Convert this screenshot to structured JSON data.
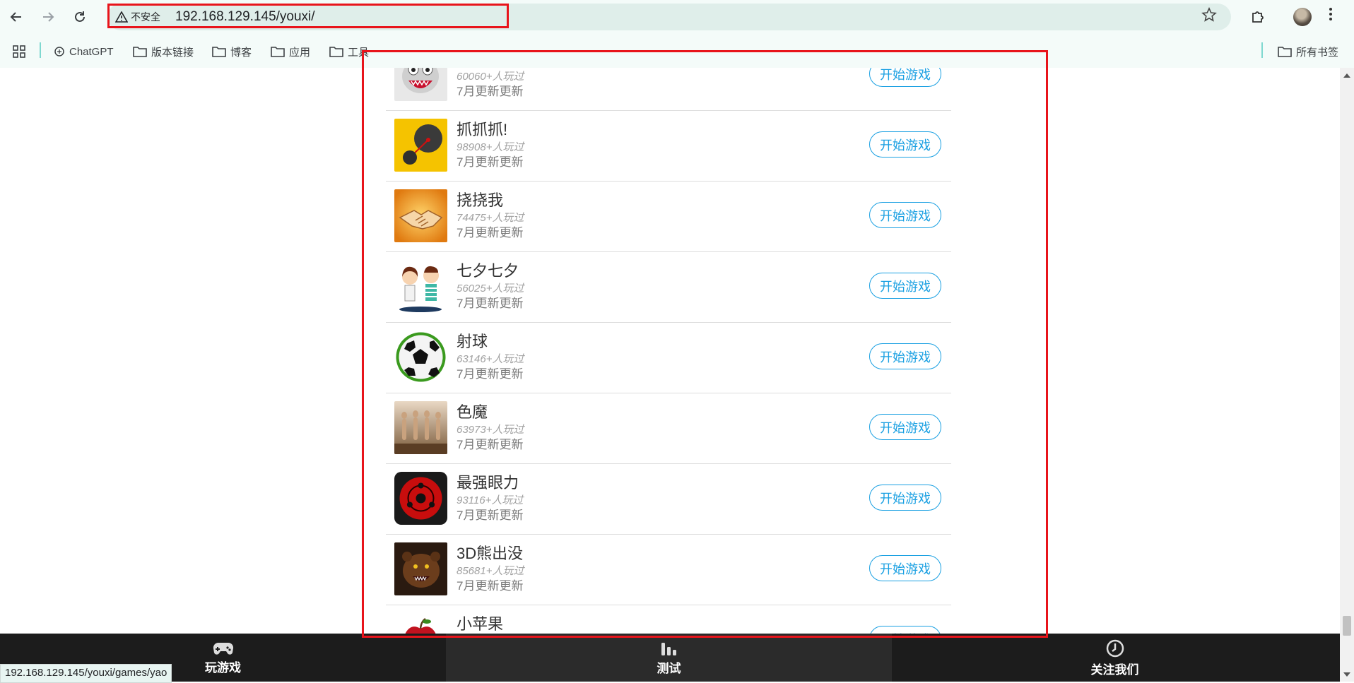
{
  "browser": {
    "security_label": "不安全",
    "url": "192.168.129.145/youxi/",
    "bookmarks": [
      {
        "label": "ChatGPT",
        "icon": "chatgpt-icon"
      },
      {
        "label": "版本链接",
        "icon": "folder-icon"
      },
      {
        "label": "博客",
        "icon": "folder-icon"
      },
      {
        "label": "应用",
        "icon": "folder-icon"
      },
      {
        "label": "工具",
        "icon": "folder-icon"
      }
    ],
    "all_bookmarks_label": "所有书签",
    "status_bar_url": "192.168.129.145/youxi/games/yao"
  },
  "games": [
    {
      "title": "",
      "plays": "60060+人玩过",
      "update": "7月更新更新",
      "button": "开始游戏",
      "icon": "monster-icon"
    },
    {
      "title": "抓抓抓!",
      "plays": "98908+人玩过",
      "update": "7月更新更新",
      "button": "开始游戏",
      "icon": "grab-icon"
    },
    {
      "title": "挠挠我",
      "plays": "74475+人玩过",
      "update": "7月更新更新",
      "button": "开始游戏",
      "icon": "handshake-icon"
    },
    {
      "title": "七夕七夕",
      "plays": "56025+人玩过",
      "update": "7月更新更新",
      "button": "开始游戏",
      "icon": "couple-icon"
    },
    {
      "title": "射球",
      "plays": "63146+人玩过",
      "update": "7月更新更新",
      "button": "开始游戏",
      "icon": "soccer-ball-icon"
    },
    {
      "title": "色魔",
      "plays": "63973+人玩过",
      "update": "7月更新更新",
      "button": "开始游戏",
      "icon": "figures-icon"
    },
    {
      "title": "最强眼力",
      "plays": "93116+人玩过",
      "update": "7月更新更新",
      "button": "开始游戏",
      "icon": "sharingan-eye-icon"
    },
    {
      "title": "3D熊出没",
      "plays": "85681+人玩过",
      "update": "7月更新更新",
      "button": "开始游戏",
      "icon": "bear-icon"
    },
    {
      "title": "小苹果",
      "plays": "",
      "update": "",
      "button": "开始游戏",
      "icon": "apple-icon"
    }
  ],
  "tabbar": [
    {
      "label": "玩游戏",
      "icon": "gamepad-icon"
    },
    {
      "label": "测试",
      "icon": "bar-chart-icon"
    },
    {
      "label": "关注我们",
      "icon": "clock-icon"
    }
  ],
  "colors": {
    "accent": "#1aa0e2",
    "highlight": "#e8141b",
    "tabbar": "#1c1c1c"
  }
}
